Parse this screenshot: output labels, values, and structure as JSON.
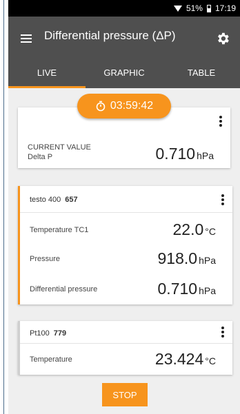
{
  "status_bar": {
    "battery": "51%",
    "time": "17:19"
  },
  "app_bar": {
    "title": "Differential pressure (ΔP)"
  },
  "tabs": [
    {
      "label": "LIVE",
      "active": true
    },
    {
      "label": "GRAPHIC",
      "active": false
    },
    {
      "label": "TABLE",
      "active": false
    }
  ],
  "timer": {
    "value": "03:59:42"
  },
  "current_card": {
    "label_line1": "CURRENT VALUE",
    "label_line2": "Delta P",
    "value": "0.710",
    "unit": "hPa"
  },
  "probe_1": {
    "name": "testo 400",
    "serial": "657",
    "rows": [
      {
        "label": "Temperature TC1",
        "value": "22.0",
        "unit": "°C"
      },
      {
        "label": "Pressure",
        "value": "918.0",
        "unit": "hPa"
      },
      {
        "label": "Differential pressure",
        "value": "0.710",
        "unit": "hPa"
      }
    ]
  },
  "probe_2": {
    "name": "Pt100",
    "serial": "779",
    "rows": [
      {
        "label": "Temperature",
        "value": "23.424",
        "unit": "°C"
      }
    ]
  },
  "stop_button": {
    "label": "STOP"
  },
  "colors": {
    "accent": "#f7941d",
    "appbar": "#4f4f4f",
    "background": "#efefef"
  }
}
